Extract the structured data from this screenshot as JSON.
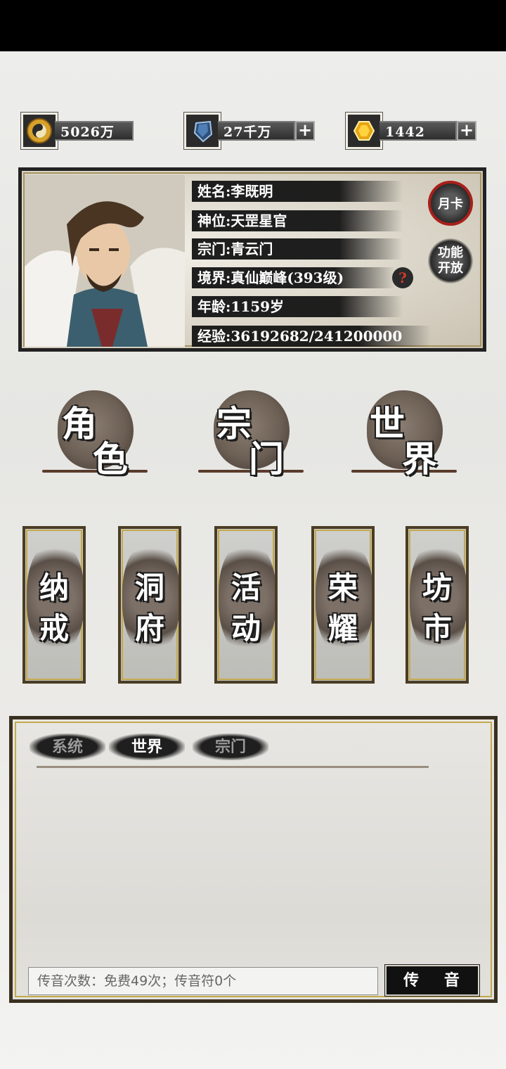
{
  "currencies": [
    {
      "icon": "taiji-coin-icon",
      "amount": "5026万"
    },
    {
      "icon": "blue-crystal-icon",
      "amount": "27千万"
    },
    {
      "icon": "gold-gem-icon",
      "amount": "1442"
    }
  ],
  "character": {
    "name": "姓名:李既明",
    "title": "神位:天罡星官",
    "sect": "宗门:青云门",
    "realm": "境界:真仙巅峰(393级)",
    "age": "年龄:1159岁",
    "exp": "经验:36192682/241200000",
    "help": "?",
    "month_card": "月卡",
    "feature_unlock_1": "功能",
    "feature_unlock_2": "开放"
  },
  "main_nav": [
    {
      "c1": "角",
      "c2": "色"
    },
    {
      "c1": "宗",
      "c2": "门"
    },
    {
      "c1": "世",
      "c2": "界"
    }
  ],
  "sub_nav": [
    {
      "c1": "纳",
      "c2": "戒"
    },
    {
      "c1": "洞",
      "c2": "府"
    },
    {
      "c1": "活",
      "c2": "动"
    },
    {
      "c1": "荣",
      "c2": "耀"
    },
    {
      "c1": "坊",
      "c2": "市"
    }
  ],
  "chat": {
    "tabs": [
      "系统",
      "世界",
      "宗门"
    ],
    "active_tab": "世界",
    "input_placeholder": "传音次数：免费49次；传音符0个",
    "send_label": "传 音"
  },
  "colors": {
    "gold_border": "#c4a94e",
    "seal_red": "#a8201a"
  }
}
